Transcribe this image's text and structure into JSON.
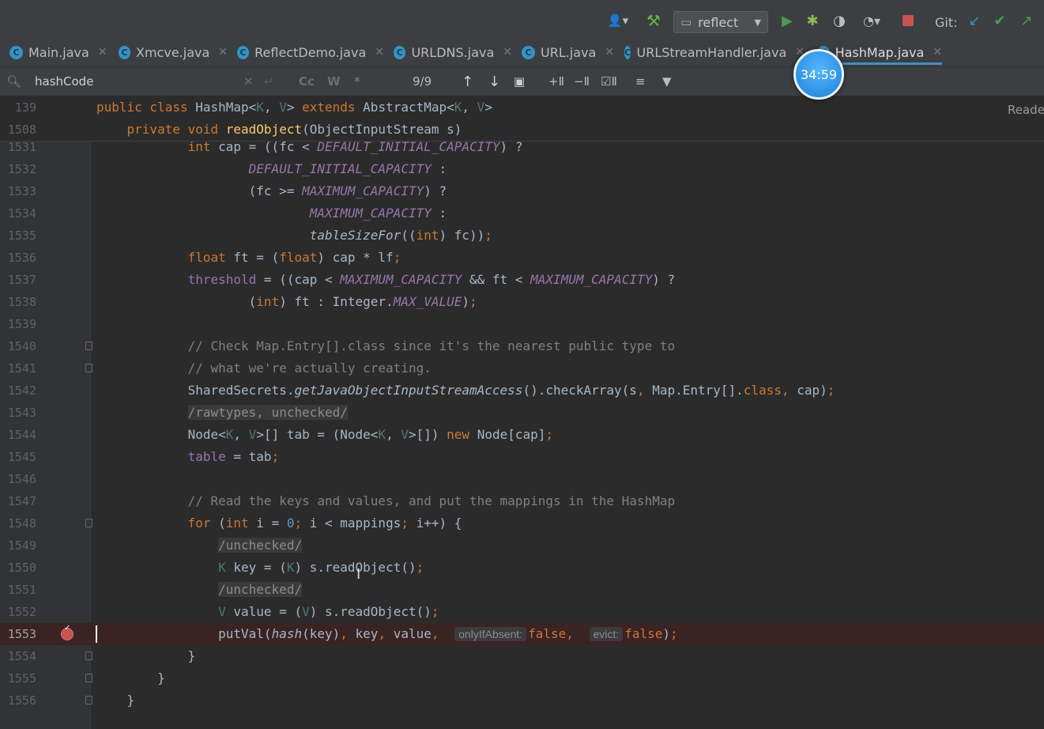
{
  "toolbar": {
    "run_config": "reflect",
    "git_label": "Git:",
    "icons": [
      "user-icon",
      "build-hammer-icon",
      "run-icon",
      "debug-icon",
      "coverage-icon",
      "profile-icon",
      "stop-icon",
      "git-update-icon",
      "git-commit-icon",
      "git-push-icon"
    ]
  },
  "tabs": [
    {
      "label": "Main.java",
      "active": false
    },
    {
      "label": "Xmcve.java",
      "active": false
    },
    {
      "label": "ReflectDemo.java",
      "active": false
    },
    {
      "label": "URLDNS.java",
      "active": false
    },
    {
      "label": "URL.java",
      "active": false
    },
    {
      "label": "URLStreamHandler.java",
      "active": false
    },
    {
      "label": "HashMap.java",
      "active": true
    }
  ],
  "search": {
    "query": "hashCode",
    "match_case_label": "Cc",
    "words_label": "W",
    "regex_label": "*",
    "result_count": "9/9"
  },
  "timer": "34:59",
  "reader_mode_label": "Reade",
  "sticky_lines": [
    {
      "num": "139"
    },
    {
      "num": "1508"
    }
  ],
  "lines": [
    {
      "num": "1531"
    },
    {
      "num": "1532"
    },
    {
      "num": "1533"
    },
    {
      "num": "1534"
    },
    {
      "num": "1535"
    },
    {
      "num": "1536"
    },
    {
      "num": "1537"
    },
    {
      "num": "1538"
    },
    {
      "num": "1539"
    },
    {
      "num": "1540"
    },
    {
      "num": "1541"
    },
    {
      "num": "1542"
    },
    {
      "num": "1543"
    },
    {
      "num": "1544"
    },
    {
      "num": "1545"
    },
    {
      "num": "1546"
    },
    {
      "num": "1547"
    },
    {
      "num": "1548"
    },
    {
      "num": "1549"
    },
    {
      "num": "1550"
    },
    {
      "num": "1551"
    },
    {
      "num": "1552"
    },
    {
      "num": "1553"
    },
    {
      "num": "1554"
    },
    {
      "num": "1555"
    },
    {
      "num": "1556"
    }
  ],
  "code": {
    "hint_only_if_absent": "onlyIfAbsent:",
    "hint_evict": "evict:"
  },
  "colors": {
    "background": "#2b2b2b",
    "gutter": "#313335",
    "keyword": "#cc7832",
    "method": "#ffc66d",
    "constant": "#9876aa",
    "comment": "#808080",
    "number": "#6897bb",
    "current_line": "#3a2323",
    "breakpoint": "#c75450",
    "active_tab_underline": "#4a88c7"
  }
}
